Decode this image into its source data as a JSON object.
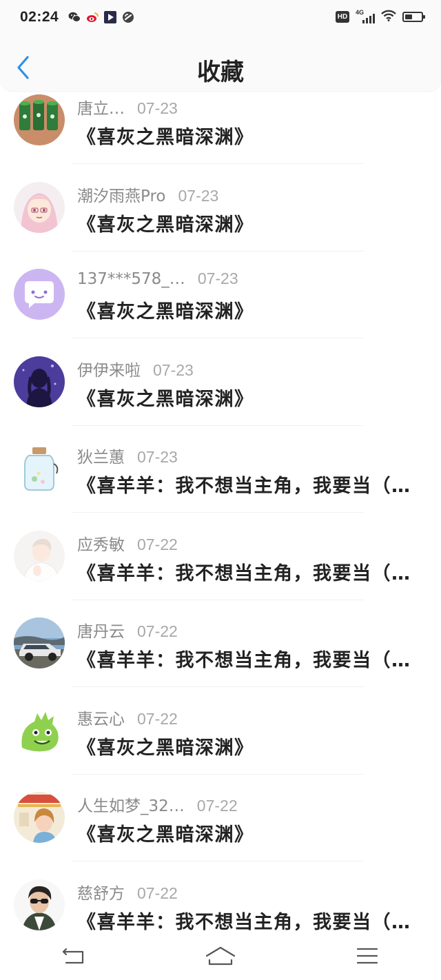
{
  "status_bar": {
    "time": "02:24",
    "hd_label": "HD",
    "network_label": "4G",
    "battery_percent": 45,
    "app_icons": [
      "wechat-icon",
      "weibo-icon",
      "video-app-icon",
      "link-app-icon"
    ]
  },
  "header": {
    "back_icon": "chevron-left-icon",
    "title": "收藏"
  },
  "colors": {
    "accent_blue": "#2f8fe6",
    "title_text": "#222222",
    "meta_text": "#8a8a8a"
  },
  "items": [
    {
      "user": "唐立…",
      "date": "07-23",
      "title": "《喜灰之黑暗深渊》",
      "avatar": "green-cups-avatar"
    },
    {
      "user": "潮汐雨燕Pro",
      "date": "07-23",
      "title": "《喜灰之黑暗深渊》",
      "avatar": "anime-girl-avatar"
    },
    {
      "user": "137***578_…",
      "date": "07-23",
      "title": "《喜灰之黑暗深渊》",
      "avatar": "default-chat-avatar"
    },
    {
      "user": "伊伊来啦",
      "date": "07-23",
      "title": "《喜灰之黑暗深渊》",
      "avatar": "purple-silhouette-avatar"
    },
    {
      "user": "狄兰蕙",
      "date": "07-23",
      "title": "《喜羊羊：我不想当主角，我要当（…",
      "avatar": "glass-jar-avatar"
    },
    {
      "user": "应秀敏",
      "date": "07-22",
      "title": "《喜羊羊：我不想当主角，我要当（…",
      "avatar": "white-portrait-avatar"
    },
    {
      "user": "唐丹云",
      "date": "07-22",
      "title": "《喜羊羊：我不想当主角，我要当（…",
      "avatar": "car-avatar"
    },
    {
      "user": "惠云心",
      "date": "07-22",
      "title": "《喜灰之黑暗深渊》",
      "avatar": "green-dinosaur-avatar"
    },
    {
      "user": "人生如梦_32…",
      "date": "07-22",
      "title": "《喜灰之黑暗深渊》",
      "avatar": "poster-avatar"
    },
    {
      "user": "慈舒方",
      "date": "07-22",
      "title": "《喜羊羊：我不想当主角，我要当（…",
      "avatar": "sunglasses-man-avatar"
    }
  ],
  "system_nav": [
    "back-icon",
    "home-icon",
    "menu-icon"
  ]
}
